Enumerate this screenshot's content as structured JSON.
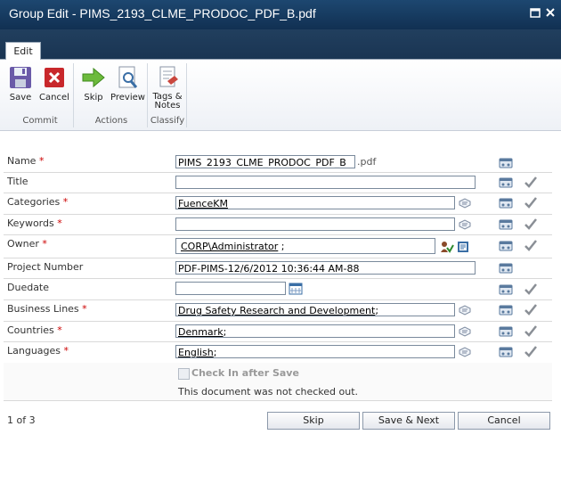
{
  "window": {
    "title": "Group Edit - PIMS_2193_CLME_PRODOC_PDF_B.pdf"
  },
  "tabs": [
    {
      "label": "Edit"
    }
  ],
  "ribbon": {
    "commit": {
      "label": "Commit",
      "save": "Save",
      "cancel": "Cancel"
    },
    "actions": {
      "label": "Actions",
      "skip": "Skip",
      "preview": "Preview"
    },
    "classify": {
      "label": "Classify",
      "tags_line1": "Tags &",
      "tags_line2": "Notes"
    }
  },
  "fields": {
    "name": {
      "label": "Name",
      "required": "*",
      "value": "PIMS_2193_CLME_PRODOC_PDF_B",
      "suffix": ".pdf"
    },
    "title": {
      "label": "Title",
      "value": ""
    },
    "categories": {
      "label": "Categories",
      "required": "*",
      "value": "FuenceKM"
    },
    "keywords": {
      "label": "Keywords",
      "required": "*",
      "value": ""
    },
    "owner": {
      "label": "Owner",
      "required": "*",
      "value_link": "CORP\\Administrator",
      "value_rest": " ;"
    },
    "project_number": {
      "label": "Project Number",
      "value": "PDF-PIMS-12/6/2012 10:36:44 AM-88"
    },
    "duedate": {
      "label": "Duedate",
      "value": ""
    },
    "business_lines": {
      "label": "Business Lines",
      "required": "*",
      "value_link": "Drug Safety Research and Development",
      "value_rest": ";"
    },
    "countries": {
      "label": "Countries",
      "required": "*",
      "value_link": "Denmark",
      "value_rest": ";"
    },
    "languages": {
      "label": "Languages",
      "required": "*",
      "value_link": "English",
      "value_rest": ";"
    }
  },
  "checkin": {
    "label": "Check In after Save",
    "note": "This document was not checked out."
  },
  "pager": {
    "text": "1 of 3"
  },
  "buttons": {
    "skip": "Skip",
    "save_next": "Save & Next",
    "cancel": "Cancel"
  }
}
